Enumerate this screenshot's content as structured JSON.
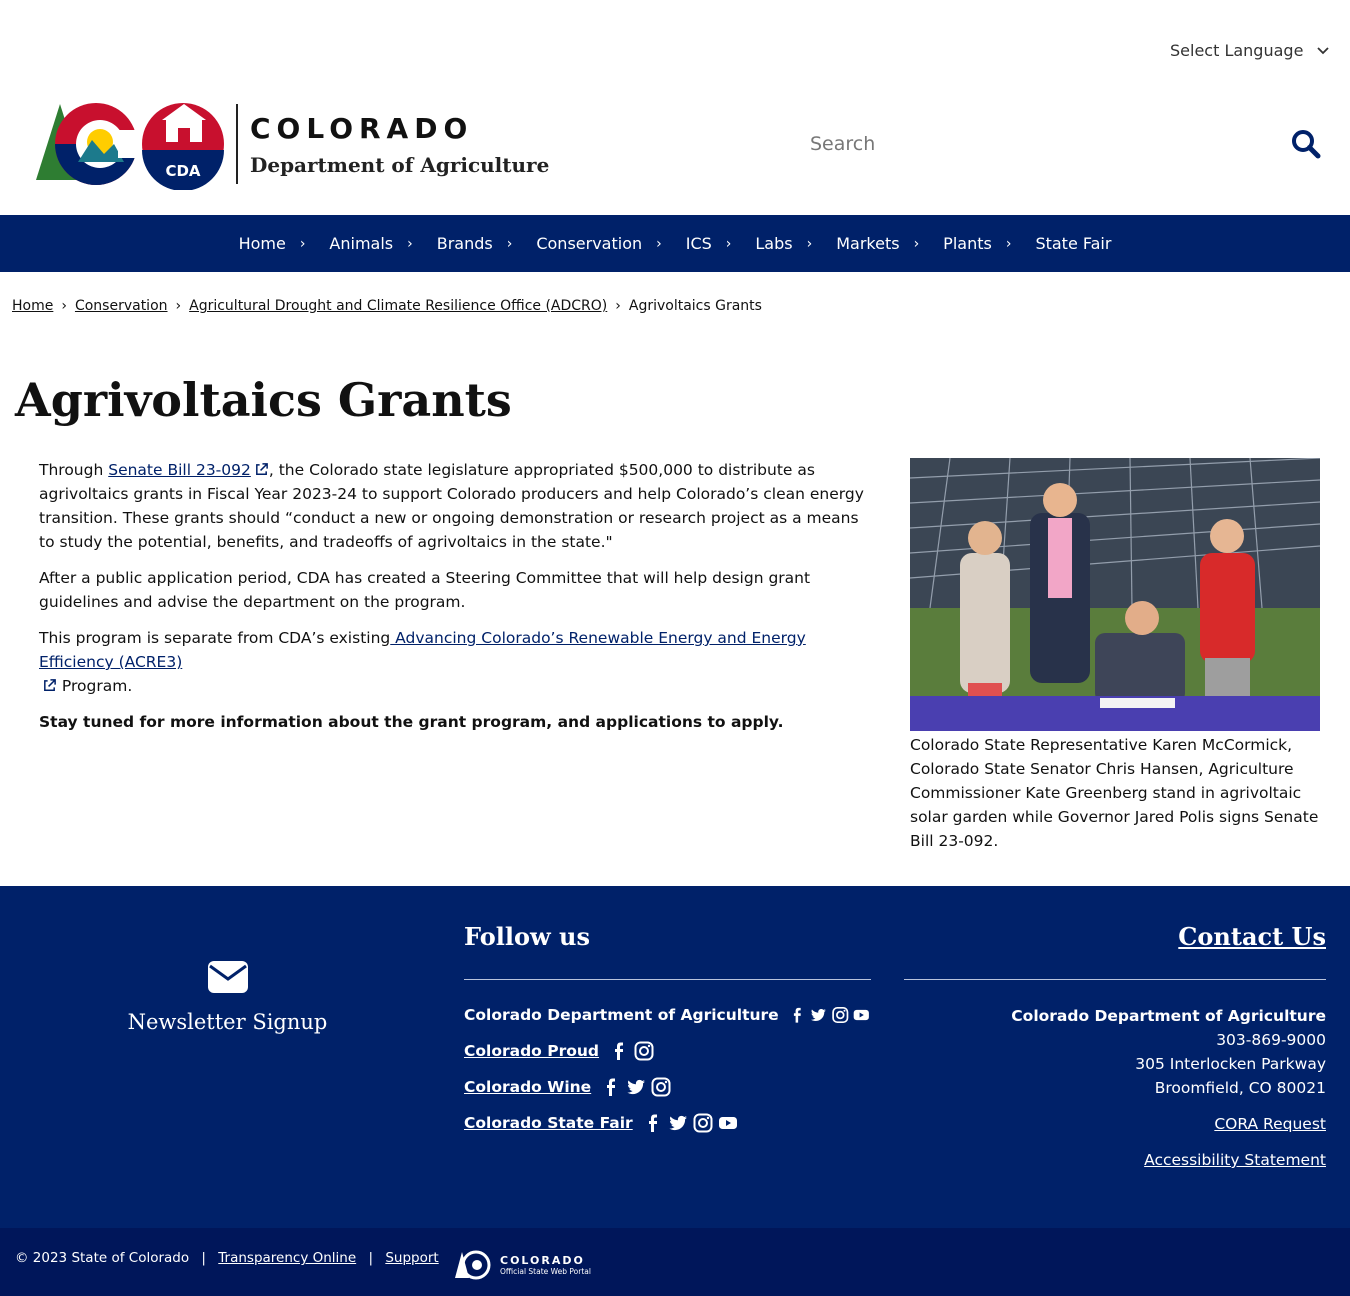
{
  "header": {
    "language_label": "Select Language",
    "logo_title": "COLORADO",
    "logo_subtitle": "Department of Agriculture",
    "logo_badge": "CDA",
    "search_placeholder": "Search"
  },
  "nav": {
    "items": [
      "Home",
      "Animals",
      "Brands",
      "Conservation",
      "ICS",
      "Labs",
      "Markets",
      "Plants",
      "State Fair"
    ]
  },
  "breadcrumb": {
    "items": [
      "Home",
      "Conservation",
      "Agricultural Drought and Climate Resilience Office (ADCRO)"
    ],
    "current": "Agrivoltaics Grants"
  },
  "page": {
    "title": "Agrivoltaics Grants",
    "p1_pre": "Through ",
    "p1_link": "Senate Bill 23-092",
    "p1_post": ", the Colorado state legislature appropriated $500,000 to distribute as agrivoltaics grants in Fiscal Year 2023-24 to support Colorado producers and help Colorado’s clean energy transition. These grants should “conduct a new or ongoing demonstration or research project as a means to study the potential, benefits, and tradeoffs of agrivoltaics in the state.\"",
    "p2": "After a public application period, CDA has created a Steering Committee that will help design grant guidelines and advise the department on the program.",
    "p3_pre": "This program is separate from CDA’s existing",
    "p3_link": " Advancing Colorado’s Renewable Energy and Energy Efficiency (ACRE3)",
    "p3_post": " Program.",
    "p4": "Stay tuned for more information about the grant program, and applications to apply.",
    "caption": "Colorado State Representative Karen McCormick, Colorado State Senator Chris Hansen, Agriculture Commissioner Kate Greenberg stand in agrivoltaic solar garden while Governor Jared Polis signs Senate Bill 23-092."
  },
  "footer": {
    "newsletter_label": "Newsletter Signup",
    "follow_title": "Follow us",
    "social": [
      {
        "name": "Colorado Department of Agriculture",
        "icons": [
          "facebook-icon",
          "twitter-icon",
          "instagram-icon",
          "youtube-icon"
        ]
      },
      {
        "name": "Colorado Proud",
        "icons": [
          "facebook-icon",
          "instagram-icon"
        ]
      },
      {
        "name": "Colorado Wine",
        "icons": [
          "facebook-icon",
          "twitter-icon",
          "instagram-icon"
        ]
      },
      {
        "name": "Colorado State Fair",
        "icons": [
          "facebook-icon",
          "twitter-icon",
          "instagram-icon",
          "youtube-icon"
        ]
      }
    ],
    "contact_title": "Contact Us",
    "contact_org": "Colorado Department of Agriculture",
    "contact_phone": "303-869-9000",
    "contact_street": "305 Interlocken Parkway",
    "contact_city": "Broomfield, CO 80021",
    "cora_link": "CORA Request",
    "accessibility_link": "Accessibility Statement",
    "copyright": "© 2023 State of Colorado",
    "transparency_link": "Transparency Online",
    "support_link": "Support",
    "portal_title": "COLORADO",
    "portal_subtitle": "Official State Web Portal"
  },
  "colors": {
    "brand_navy": "#002169",
    "bottom_bar": "#00165a",
    "co_red": "#c8102e",
    "co_gold": "#ffcd00",
    "tree_green": "#2e7d32"
  }
}
